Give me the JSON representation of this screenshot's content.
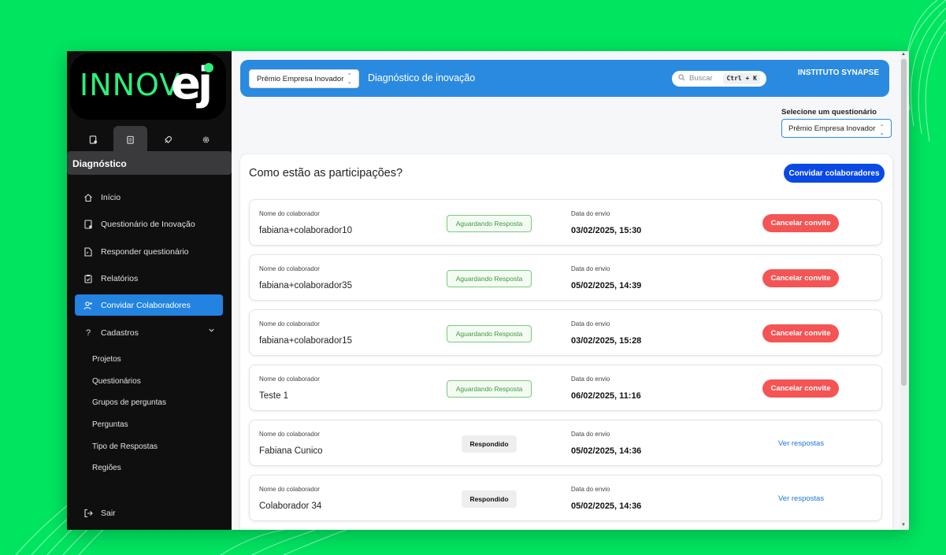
{
  "brand": {
    "logo_text": "INNOV",
    "logo_ej": "ej"
  },
  "sidebar": {
    "section_title": "Diagnóstico",
    "items": [
      {
        "label": "Início",
        "icon": "home-icon"
      },
      {
        "label": "Questionário de Inovação",
        "icon": "document-icon"
      },
      {
        "label": "Responder questionário",
        "icon": "file-edit-icon"
      },
      {
        "label": "Relatórios",
        "icon": "clipboard-icon"
      },
      {
        "label": "Convidar Colaboradores",
        "icon": "user-plus-icon",
        "active": true
      },
      {
        "label": "Cadastros",
        "icon": "question-icon"
      }
    ],
    "subitems": [
      "Projetos",
      "Questionários",
      "Grupos de perguntas",
      "Perguntas",
      "Tipo de Respostas",
      "Regiões"
    ],
    "logout": "Sair"
  },
  "topbar": {
    "project_select": "Prêmio Empresa Inovador",
    "title": "Diagnóstico de inovação",
    "search_placeholder": "Buscar",
    "shortcut": "Ctrl + K",
    "institute": "INSTITUTO SYNAPSE"
  },
  "questionnaire": {
    "label": "Selecione um questionário",
    "selected": "Prêmio Empresa Inovador"
  },
  "participations": {
    "title": "Como estão as participações?",
    "invite_button": "Convidar colaboradores",
    "name_label": "Nome do colaborador",
    "date_label": "Data do envio",
    "rows": [
      {
        "name": "fabiana+colaborador10",
        "status": "Aguardando Resposta",
        "date": "03/02/2025, 15:30",
        "action": "Cancelar convite"
      },
      {
        "name": "fabiana+colaborador35",
        "status": "Aguardando Resposta",
        "date": "05/02/2025, 14:39",
        "action": "Cancelar convite"
      },
      {
        "name": "fabiana+colaborador15",
        "status": "Aguardando Resposta",
        "date": "03/02/2025, 15:28",
        "action": "Cancelar convite"
      },
      {
        "name": "Teste 1",
        "status": "Aguardando Resposta",
        "date": "06/02/2025, 11:16",
        "action": "Cancelar convite"
      },
      {
        "name": "Fabiana Cunico",
        "status": "Respondido",
        "date": "05/02/2025, 14:36",
        "action": "Ver respostas"
      },
      {
        "name": "Colaborador 34",
        "status": "Respondido",
        "date": "05/02/2025, 14:36",
        "action": "Ver respostas"
      }
    ]
  },
  "colors": {
    "accent": "#2a8ae0",
    "primary_button": "#0a49e6",
    "danger": "#f45454",
    "background": "#00e560"
  }
}
